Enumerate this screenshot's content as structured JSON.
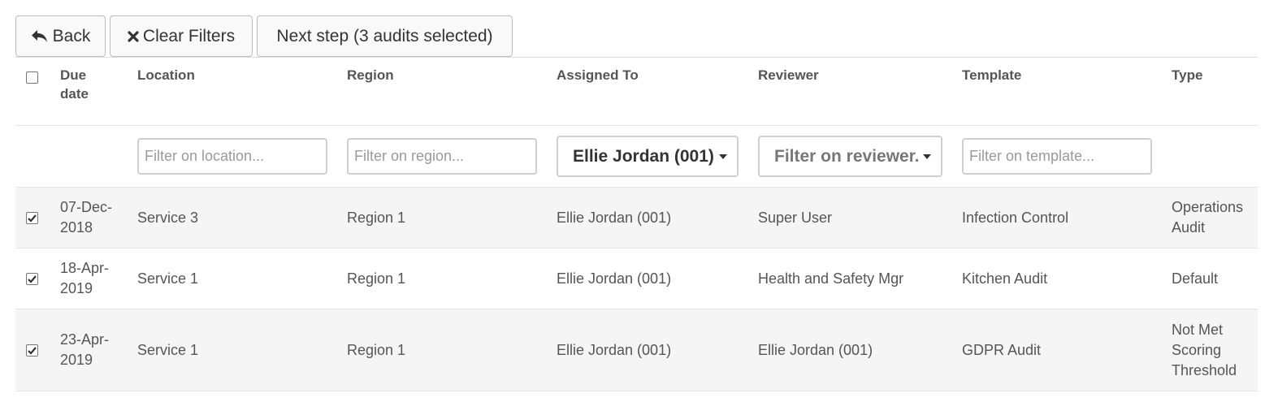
{
  "toolbar": {
    "back_label": "Back",
    "clear_label": "Clear Filters",
    "next_label": "Next step (3 audits selected)"
  },
  "columns": {
    "due_date": "Due\ndate",
    "location": "Location",
    "region": "Region",
    "assigned_to": "Assigned To",
    "reviewer": "Reviewer",
    "template": "Template",
    "type": "Type"
  },
  "filters": {
    "location_placeholder": "Filter on location...",
    "region_placeholder": "Filter on region...",
    "assigned_value": "Ellie Jordan (001)",
    "reviewer_placeholder": "Filter on reviewer...",
    "template_placeholder": "Filter on template..."
  },
  "rows": [
    {
      "checked": true,
      "due": "07-Dec-2018",
      "location": "Service 3",
      "region": "Region 1",
      "assigned": "Ellie Jordan (001)",
      "reviewer": "Super User",
      "template": "Infection Control",
      "type": "Operations Audit"
    },
    {
      "checked": true,
      "due": "18-Apr-2019",
      "location": "Service 1",
      "region": "Region 1",
      "assigned": "Ellie Jordan (001)",
      "reviewer": "Health and Safety Mgr",
      "template": "Kitchen Audit",
      "type": "Default"
    },
    {
      "checked": true,
      "due": "23-Apr-2019",
      "location": "Service 1",
      "region": "Region 1",
      "assigned": "Ellie Jordan (001)",
      "reviewer": "Ellie Jordan (001)",
      "template": "GDPR Audit",
      "type": "Not Met Scoring Threshold"
    }
  ],
  "icons": {
    "back": "reply-arrow-icon",
    "clear": "close-icon",
    "check": "checkmark-icon",
    "dropdown": "caret-down-icon"
  }
}
